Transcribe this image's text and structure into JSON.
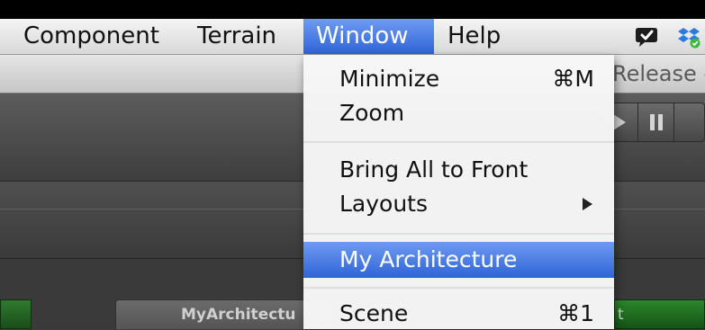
{
  "menubar": {
    "items": [
      "Component",
      "Terrain",
      "Window",
      "Help"
    ],
    "active_index": 2,
    "status_icons": [
      "speech-bubble-icon",
      "dropbox-icon"
    ]
  },
  "app": {
    "title_text": "Release -",
    "tabs": {
      "project_label": "MyArchitectu",
      "right_label": "t"
    }
  },
  "dropdown": {
    "items": [
      {
        "label": "Minimize",
        "shortcut": "⌘M"
      },
      {
        "label": "Zoom",
        "shortcut": ""
      },
      {
        "label": "Bring All to Front",
        "shortcut": ""
      },
      {
        "label": "Layouts",
        "submenu": true
      },
      {
        "label": "My Architecture",
        "highlighted": true
      },
      {
        "label": "Scene",
        "shortcut": "⌘1"
      }
    ]
  },
  "colors": {
    "highlight": "#3a6fdd",
    "menubar": "#e4e4e4",
    "green_tab": "#2c862c"
  }
}
